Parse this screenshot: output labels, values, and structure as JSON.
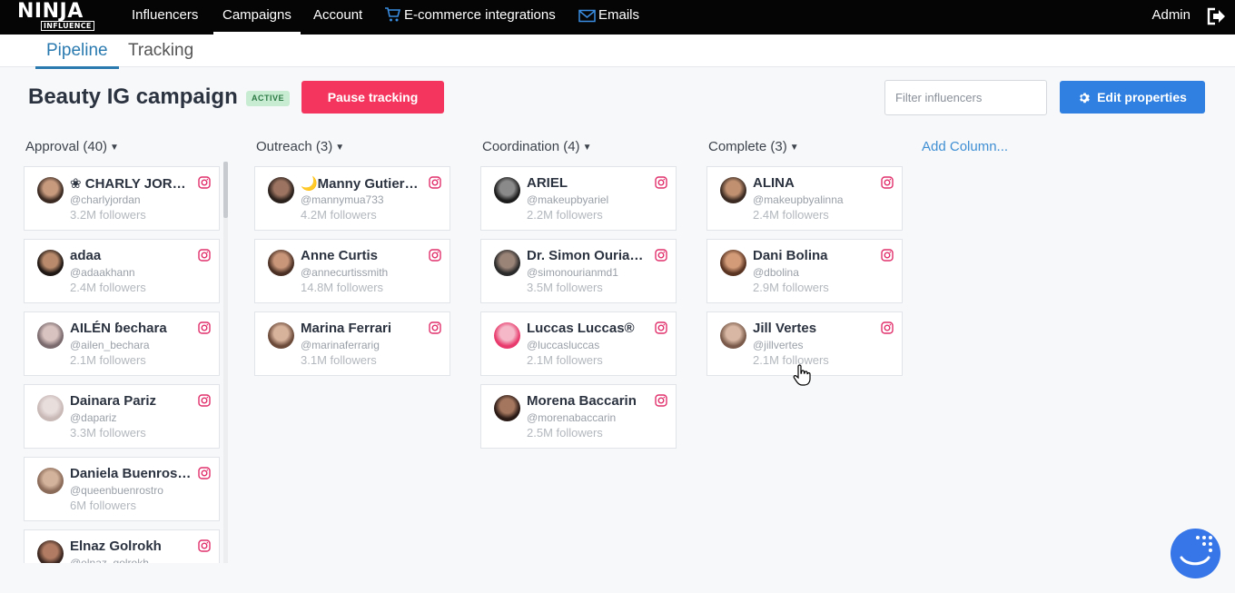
{
  "app": {
    "logo_top": "NINJA",
    "logo_bottom": "INFLUENCE",
    "nav": [
      "Influencers",
      "Campaigns",
      "Account",
      "E-commerce integrations",
      "Emails"
    ],
    "nav_icons": [
      "cart-icon",
      "mail-icon"
    ],
    "user": "Admin"
  },
  "subtabs": [
    "Pipeline",
    "Tracking"
  ],
  "campaign": {
    "title": "Beauty IG campaign",
    "status": "ACTIVE",
    "pause_label": "Pause tracking",
    "filter_placeholder": "Filter influencers",
    "edit_label": "Edit properties"
  },
  "colors": {
    "nav_bg": "#050505",
    "accent": "#2a7ab0",
    "pause": "#f4365e",
    "edit": "#2f80e0",
    "badge_bg": "#c7ecd2",
    "instagram": "#e1306c"
  },
  "columns": [
    {
      "title": "Approval (40)",
      "cards": [
        {
          "name": "❀ CHARLY JORDAN ✨",
          "handle": "@charlyjordan",
          "followers": "3.2M followers"
        },
        {
          "name": "adaa",
          "handle": "@adaakhann",
          "followers": "2.4M followers"
        },
        {
          "name": "AILÉN ɓechara",
          "handle": "@ailen_bechara",
          "followers": "2.1M followers"
        },
        {
          "name": "Dainara Pariz",
          "handle": "@dapariz",
          "followers": "3.3M followers"
        },
        {
          "name": "Daniela Buenrostro",
          "handle": "@queenbuenrostro",
          "followers": "6M followers"
        },
        {
          "name": "Elnaz Golrokh",
          "handle": "@elnaz_golrokh",
          "followers": ""
        }
      ]
    },
    {
      "title": "Outreach (3)",
      "cards": [
        {
          "name": "🌙Manny Gutierrez",
          "handle": "@mannymua733",
          "followers": "4.2M followers"
        },
        {
          "name": "Anne Curtis",
          "handle": "@annecurtissmith",
          "followers": "14.8M followers"
        },
        {
          "name": "Marina Ferrari",
          "handle": "@marinaferrarig",
          "followers": "3.1M followers"
        }
      ]
    },
    {
      "title": "Coordination (4)",
      "cards": [
        {
          "name": "ARIEL",
          "handle": "@makeupbyariel",
          "followers": "2.2M followers"
        },
        {
          "name": "Dr. Simon Ourian M.D.",
          "handle": "@simonourianmd1",
          "followers": "3.5M followers"
        },
        {
          "name": "Luccas Luccas®",
          "handle": "@luccasluccas",
          "followers": "2.1M followers"
        },
        {
          "name": "Morena Baccarin",
          "handle": "@morenabaccarin",
          "followers": "2.5M followers"
        }
      ]
    },
    {
      "title": "Complete (3)",
      "cards": [
        {
          "name": "ALINA",
          "handle": "@makeupbyalinna",
          "followers": "2.4M followers"
        },
        {
          "name": "Dani Bolina",
          "handle": "@dbolina",
          "followers": "2.9M followers"
        },
        {
          "name": "Jill Vertes",
          "handle": "@jillvertes",
          "followers": "2.1M followers"
        }
      ]
    }
  ],
  "add_column": "Add Column..."
}
